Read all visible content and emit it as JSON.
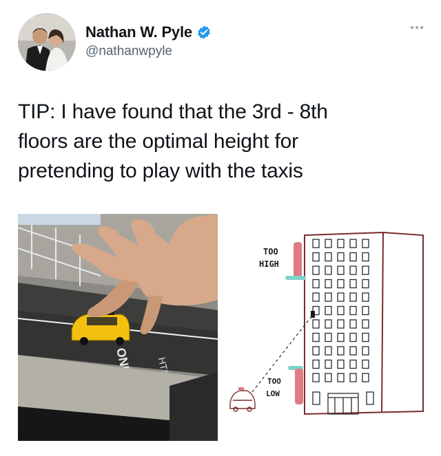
{
  "author": {
    "display_name": "Nathan W. Pyle",
    "handle": "@nathanwpyle",
    "verified_icon": "verified-badge-icon",
    "avatar_icon": "wedding-photo-avatar"
  },
  "tweet": {
    "text_lines": [
      "TIP: I have found that the 3rd - 8th",
      "floors are the optimal height for",
      "pretending to play with the taxis"
    ]
  },
  "more_options_icon": "more-horizontal-icon",
  "illustration": {
    "label_high_line1": "TOO",
    "label_high_line2": "HIGH",
    "label_low_line1": "TOO",
    "label_low_line2": "LOW"
  },
  "photo": {
    "street_marking": "ONE",
    "building_number": "HTS"
  },
  "colors": {
    "verified": "#1d9bf0",
    "text": "#0f1419",
    "secondary_text": "#536471",
    "taxi": "#f2c10f",
    "marker_high": "#e07a84",
    "marker_teal": "#7fd3c9",
    "building_outline": "#7a2b2b"
  }
}
